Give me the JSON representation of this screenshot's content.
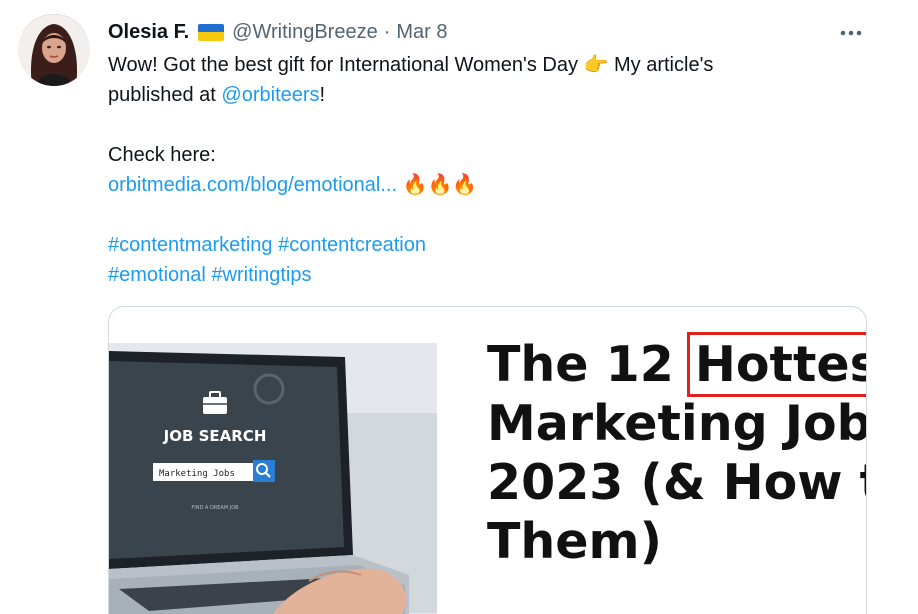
{
  "author": {
    "name": "Olesia F.",
    "handle": "@WritingBreeze",
    "separator": "·",
    "date": "Mar 8"
  },
  "more_icon": "more-horizontal-icon",
  "tweet": {
    "line1": "Wow! Got the best gift for International Women's Day",
    "line1_emoji": "👉",
    "line1_end": "My article's",
    "line2_start": "published at ",
    "mention": "@orbiteers",
    "line2_end": "!",
    "check_here": "Check here:",
    "url": "orbitmedia.com/blog/emotional...",
    "fire_emojis": "🔥🔥🔥",
    "hashtags_line1": [
      "#contentmarketing",
      "#contentcreation"
    ],
    "hashtags_line2": [
      "#emotional",
      "#writingtips"
    ]
  },
  "card": {
    "image": {
      "heading": "JOB SEARCH",
      "search_value": "Marketing Jobs",
      "subtext": "FIND A DREAM JOB"
    },
    "title_pre": "The 12 ",
    "title_highlight": "Hottest",
    "title_line2": "Marketing Job",
    "title_line3": "2023 (& How t",
    "title_line4": "Them)"
  },
  "colors": {
    "link": "#1d9bf0",
    "secondary_text": "#536471",
    "highlight_box": "#e0211d"
  }
}
